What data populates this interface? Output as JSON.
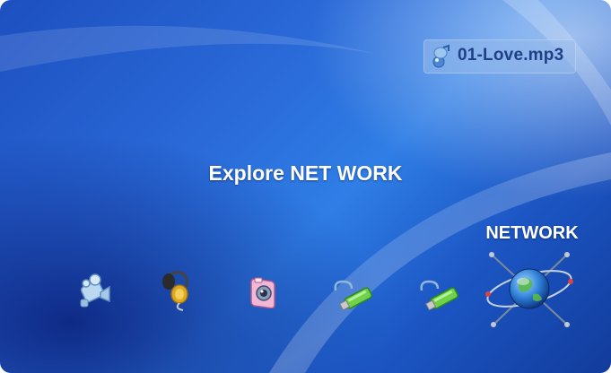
{
  "now_playing": {
    "filename": "01-Love.mp3",
    "icon": "music-note-icon"
  },
  "main": {
    "title": "Explore NET WORK"
  },
  "menu": {
    "selected_label": "NETWORK",
    "items": [
      {
        "id": "video",
        "icon": "video-camera-icon"
      },
      {
        "id": "music",
        "icon": "headphones-icon"
      },
      {
        "id": "photo",
        "icon": "camera-icon"
      },
      {
        "id": "usb-1",
        "icon": "usb-drive-icon"
      },
      {
        "id": "usb-2",
        "icon": "usb-drive-icon"
      },
      {
        "id": "network",
        "icon": "globe-network-icon",
        "selected": true
      }
    ]
  },
  "colors": {
    "background": "#2a6ad8",
    "label_text": "#ffffff",
    "badge_text": "#1f3f86"
  }
}
